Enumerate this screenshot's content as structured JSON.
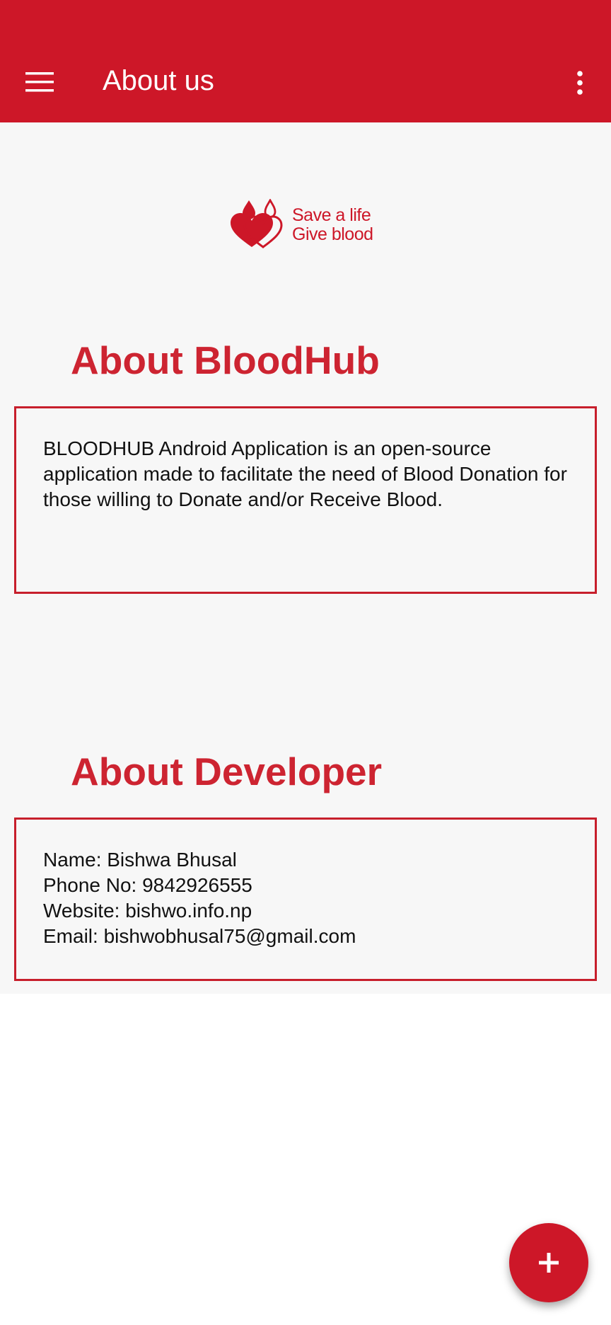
{
  "app_bar": {
    "title": "About us",
    "menu_icon": "menu-icon",
    "overflow_icon": "more-vert-icon",
    "background_color": "#cd1728"
  },
  "logo": {
    "line1": "Save a life",
    "line2": "Give blood",
    "icon": "blood-drop-hearts-icon"
  },
  "about_app": {
    "heading": "About BloodHub",
    "description": "BLOODHUB Android Application is an open-source application made to facilitate the need of Blood Donation for those willing to Donate and/or Receive Blood."
  },
  "about_developer": {
    "heading": "About Developer",
    "name": "Name: Bishwa Bhusal",
    "phone": "Phone No: 9842926555",
    "website": "Website: bishwo.info.np",
    "email": "Email: bishwobhusal75@gmail.com"
  },
  "fab": {
    "icon": "plus-icon",
    "color": "#cd1728"
  },
  "colors": {
    "accent": "#cd1728",
    "heading_red": "#cd2431",
    "content_background": "#f7f7f7"
  }
}
